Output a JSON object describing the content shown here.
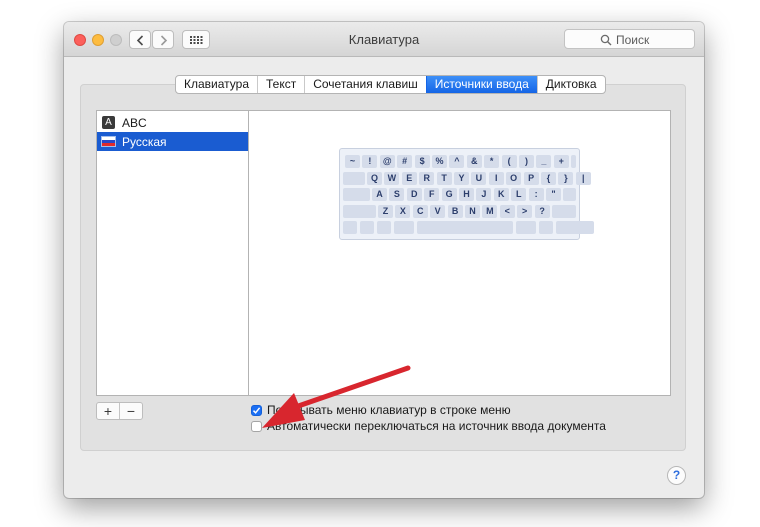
{
  "window": {
    "title": "Клавиатура"
  },
  "search": {
    "placeholder": "Поиск"
  },
  "tabs": [
    {
      "label": "Клавиатура",
      "active": false
    },
    {
      "label": "Текст",
      "active": false
    },
    {
      "label": "Сочетания клавиш",
      "active": false
    },
    {
      "label": "Источники ввода",
      "active": true
    },
    {
      "label": "Диктовка",
      "active": false
    }
  ],
  "sources": [
    {
      "label": "ABC",
      "icon": "letter-a-icon",
      "selected": false
    },
    {
      "label": "Русская",
      "icon": "russian-flag-icon",
      "selected": true
    }
  ],
  "keyboard": {
    "rows": [
      [
        "~",
        "!",
        "@",
        "#",
        "$",
        "%",
        "^",
        "&",
        "*",
        "(",
        ")",
        "_",
        "+"
      ],
      [
        "Q",
        "W",
        "E",
        "R",
        "T",
        "Y",
        "U",
        "I",
        "O",
        "P",
        "{",
        "}",
        "|"
      ],
      [
        "A",
        "S",
        "D",
        "F",
        "G",
        "H",
        "J",
        "K",
        "L",
        ":",
        "\""
      ],
      [
        "Z",
        "X",
        "C",
        "V",
        "B",
        "N",
        "M",
        "<",
        ">",
        "?"
      ]
    ]
  },
  "buttons": {
    "add": "+",
    "remove": "−",
    "help": "?"
  },
  "options": {
    "show_menu": {
      "label": "Показывать меню клавиатур в строке меню",
      "checked": true
    },
    "auto_switch": {
      "label": "Автоматически переключаться на источник ввода документа",
      "checked": false
    }
  },
  "colors": {
    "accent": "#1b6ff4",
    "selection": "#1a5cd1",
    "annotation_arrow": "#d8262e"
  }
}
